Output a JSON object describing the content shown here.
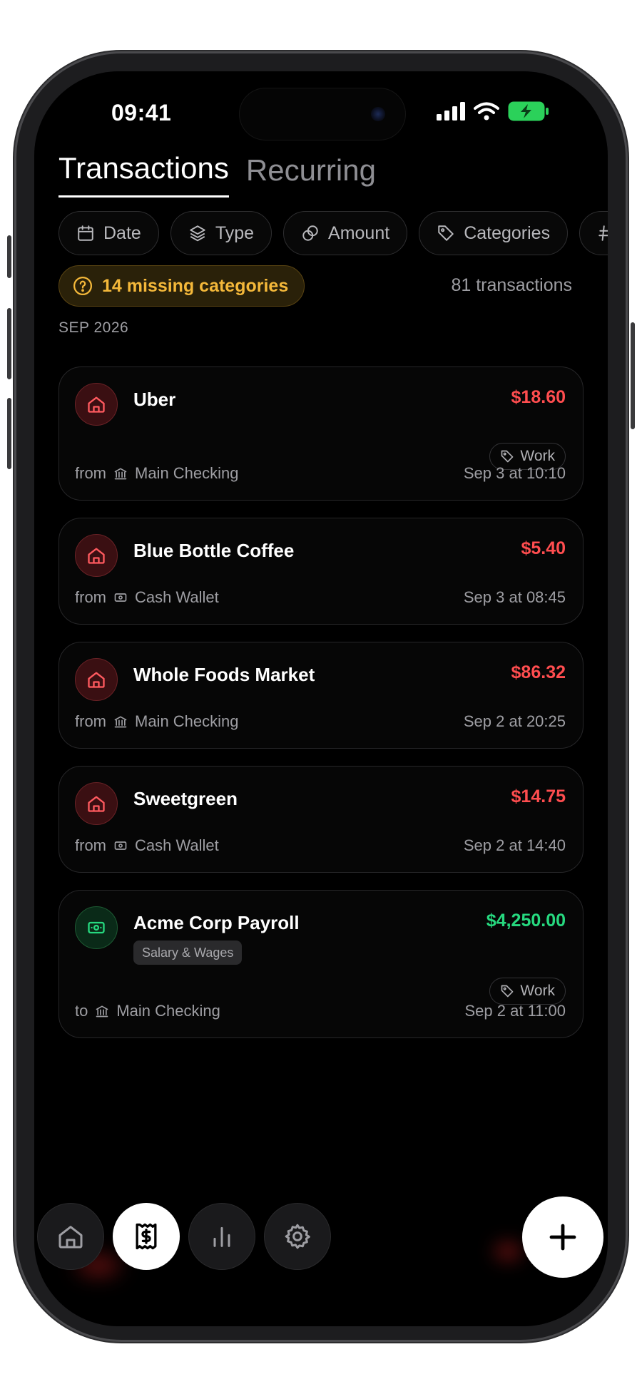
{
  "status": {
    "time": "09:41"
  },
  "tabs": [
    {
      "label": "Transactions",
      "active": true
    },
    {
      "label": "Recurring",
      "active": false
    }
  ],
  "filters": [
    {
      "label": "Date",
      "icon": "calendar-icon"
    },
    {
      "label": "Type",
      "icon": "layers-icon"
    },
    {
      "label": "Amount",
      "icon": "coins-icon"
    },
    {
      "label": "Categories",
      "icon": "tag-icon"
    }
  ],
  "summary": {
    "missing": "14 missing categories",
    "count": "81 transactions",
    "month": "SEP 2026"
  },
  "transactions": [
    {
      "name": "Uber",
      "amount": "$18.60",
      "direction": "from",
      "account": "Main Checking",
      "date": "Sep 3 at 10:10",
      "tag": "Work"
    },
    {
      "name": "Blue Bottle Coffee",
      "amount": "$5.40",
      "direction": "from",
      "account": "Cash Wallet",
      "date": "Sep 3 at 08:45"
    },
    {
      "name": "Whole Foods Market",
      "amount": "$86.32",
      "direction": "from",
      "account": "Main Checking",
      "date": "Sep 2 at 20:25"
    },
    {
      "name": "Sweetgreen",
      "amount": "$14.75",
      "direction": "from",
      "account": "Cash Wallet",
      "date": "Sep 2 at 14:40"
    },
    {
      "name": "Acme Corp Payroll",
      "amount": "$4,250.00",
      "direction": "to",
      "account": "Main Checking",
      "date": "Sep 2 at 11:00",
      "tag": "Work",
      "category": "Salary & Wages"
    }
  ],
  "colors": {
    "expense": "#ff4d4f",
    "income": "#26d97f",
    "warning": "#f4b83a"
  }
}
